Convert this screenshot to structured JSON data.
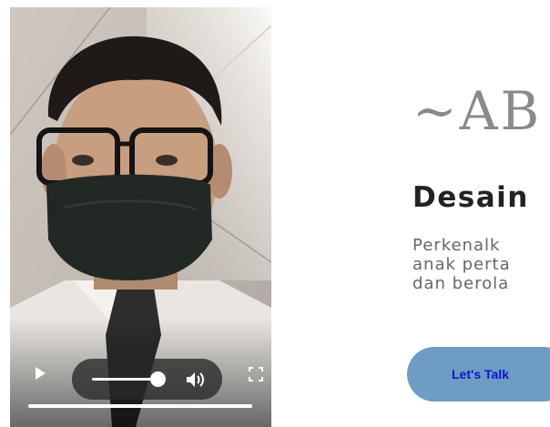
{
  "video": {
    "playback_progress": 1.0,
    "volume_level": 0.85,
    "controls": {
      "play_icon": "play-icon",
      "speaker_icon": "speaker-icon",
      "fullscreen_icon": "fullscreen-icon"
    }
  },
  "about": {
    "title": "~AB",
    "subtitle": "Desain",
    "intro_lines": [
      "Perkenalk",
      "anak perta",
      "dan berola"
    ]
  },
  "cta": {
    "label": "Let's Talk"
  },
  "colors": {
    "button_bg": "#6d9dc3",
    "button_text": "#1212cf",
    "title_text": "#8a8a8a"
  }
}
